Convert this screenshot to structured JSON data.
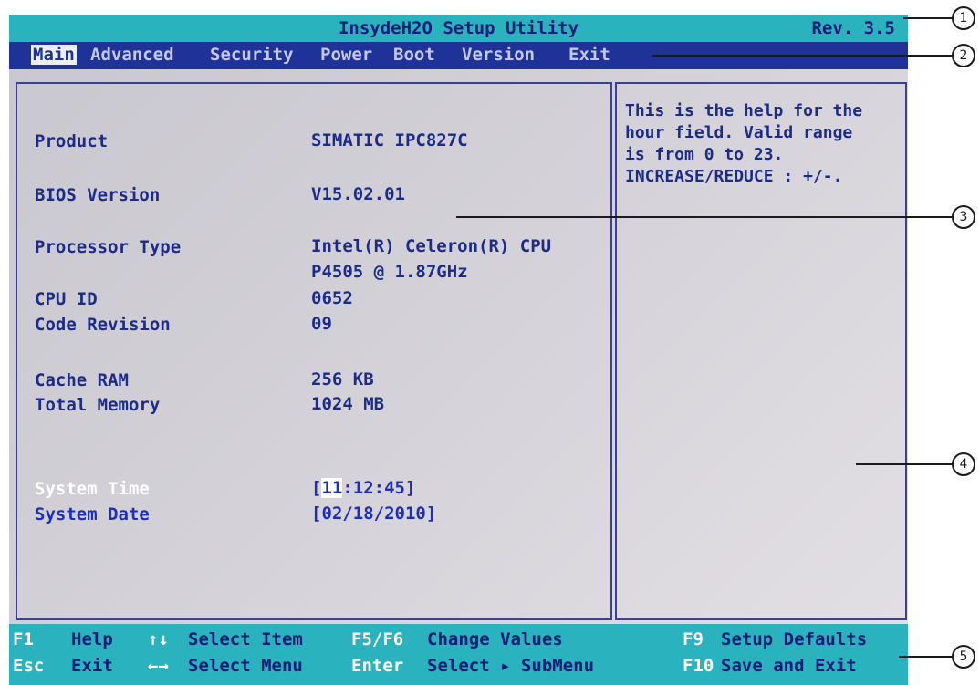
{
  "title_bar": {
    "title": "InsydeH2O Setup Utility",
    "revision": "Rev. 3.5"
  },
  "menu": [
    {
      "label": "Main",
      "active": true
    },
    {
      "label": "Advanced"
    },
    {
      "label": "Security"
    },
    {
      "label": "Power"
    },
    {
      "label": "Boot"
    },
    {
      "label": "Version"
    },
    {
      "label": "Exit"
    }
  ],
  "main": {
    "rows": [
      {
        "label": "Product",
        "value": "SIMATIC IPC827C"
      },
      {
        "label": "BIOS Version",
        "value": "V15.02.01"
      },
      {
        "label": "Processor Type",
        "value": "Intel(R) Celeron(R) CPU",
        "value2": "P4505  @ 1.87GHz"
      },
      {
        "label": "CPU ID",
        "value": "0652"
      },
      {
        "label": "Code Revision",
        "value": "09"
      },
      {
        "label": "Cache RAM",
        "value": "256 KB"
      },
      {
        "label": "Total Memory",
        "value": "1024 MB"
      }
    ],
    "system_time": {
      "label": "System Time",
      "open": "[",
      "hour": "11",
      "rest": ":12:45]"
    },
    "system_date": {
      "label": "System Date",
      "value": "[02/18/2010]"
    }
  },
  "help": {
    "lines": [
      "This is the help for the",
      "hour field. Valid range",
      "is from 0 to 23.",
      "INCREASE/REDUCE : +/-."
    ]
  },
  "status_bar": [
    {
      "key": "F1",
      "desc": "Help"
    },
    {
      "key": "↑↓",
      "desc": "Select Item"
    },
    {
      "key": "F5/F6",
      "desc": "Change Values"
    },
    {
      "key": "F9",
      "desc": "Setup Defaults"
    },
    {
      "key": "Esc",
      "desc": "Exit"
    },
    {
      "key": "←→",
      "desc": "Select Menu"
    },
    {
      "key": "Enter",
      "desc": "Select ▸ SubMenu"
    },
    {
      "key": "F10",
      "desc": "Save and Exit"
    }
  ],
  "callouts": [
    "1",
    "2",
    "3",
    "4",
    "5"
  ],
  "colors": {
    "title_bg": "#2ab3bf",
    "menu_bg": "#1e3298",
    "panel_border": "#3c3f96",
    "text": "#1c2b88"
  }
}
